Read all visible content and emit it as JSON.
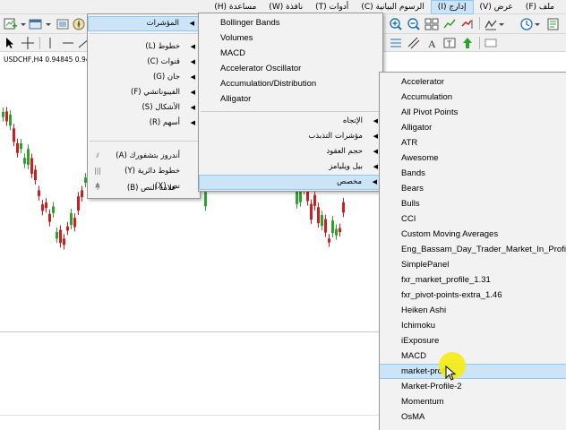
{
  "menubar": {
    "items": [
      {
        "label": "ملف (F)"
      },
      {
        "label": "عرض (V)"
      },
      {
        "label": "إدارج (I)"
      },
      {
        "label": "الرسوم البيانية (C)"
      },
      {
        "label": "أدوات (T)"
      },
      {
        "label": "نافذة (W)"
      },
      {
        "label": "مساعدة (H)"
      }
    ]
  },
  "chart": {
    "symbol_label": "USDCHF,H4  0.94845 0.94"
  },
  "insert_menu": {
    "items": [
      {
        "label": "المؤشرات",
        "submenu": true
      },
      {
        "label": "خطوط (L)",
        "submenu": true
      },
      {
        "label": "قنوات (C)",
        "submenu": true
      },
      {
        "label": "جان (G)",
        "submenu": true
      },
      {
        "label": "الفيبوناتشي (F)",
        "submenu": true
      },
      {
        "label": "الأشكال (S)",
        "submenu": true
      },
      {
        "label": "أسهم (R)",
        "submenu": true
      },
      {
        "label": "أندروز بتشفورك (A)",
        "icon": "pitchfork-icon",
        "glyph": "⫽"
      },
      {
        "label": "خطوط دائرية (Y)",
        "icon": "cycle-lines-icon",
        "glyph": "|||"
      },
      {
        "label": "نص (X)",
        "icon": "text-icon",
        "glyph": "A"
      },
      {
        "label": "علامة النص (B)",
        "icon": "text-label-icon",
        "glyph": "T"
      }
    ]
  },
  "indicators_menu": {
    "items": [
      {
        "label": "Bollinger Bands"
      },
      {
        "label": "Volumes"
      },
      {
        "label": "MACD"
      },
      {
        "label": "Accelerator Oscillator"
      },
      {
        "label": "Accumulation/Distribution"
      },
      {
        "label": "Alligator"
      }
    ],
    "groups": [
      {
        "label": "الإتجاه",
        "submenu": true
      },
      {
        "label": "مؤشرات التذبذب",
        "submenu": true
      },
      {
        "label": "حجم العقود",
        "submenu": true
      },
      {
        "label": "بيل ويليامز",
        "submenu": true
      },
      {
        "label": "مخصص",
        "submenu": true
      }
    ]
  },
  "custom_menu": {
    "items": [
      {
        "label": "Accelerator"
      },
      {
        "label": "Accumulation"
      },
      {
        "label": "All Pivot Points"
      },
      {
        "label": "Alligator"
      },
      {
        "label": "ATR"
      },
      {
        "label": "Awesome"
      },
      {
        "label": "Bands"
      },
      {
        "label": "Bears"
      },
      {
        "label": "Bulls"
      },
      {
        "label": "CCI"
      },
      {
        "label": "Custom Moving Averages"
      },
      {
        "label": "Eng_Bassam_Day_Trader_Market_In_Profile"
      },
      {
        "label": "SimplePanel"
      },
      {
        "label": "fxr_market_profile_1.31"
      },
      {
        "label": "fxr_pivot-points-extra_1.46"
      },
      {
        "label": "Heiken Ashi"
      },
      {
        "label": "Ichimoku"
      },
      {
        "label": "iExposure"
      },
      {
        "label": "MACD"
      },
      {
        "label": "market-profi"
      },
      {
        "label": "Market-Profile-2"
      },
      {
        "label": "Momentum"
      },
      {
        "label": "OsMA"
      }
    ]
  },
  "colors": {
    "bull": "#2ea02e",
    "bear": "#cc1f1f",
    "highlight": "#cce4f7",
    "highlight_border": "#90c8f6"
  }
}
